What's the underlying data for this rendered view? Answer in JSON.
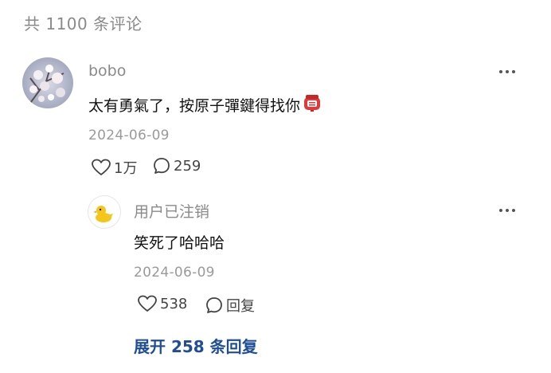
{
  "header": {
    "comment_count_label": "共 1100 条评论"
  },
  "comments": [
    {
      "author": "bobo",
      "text": "太有勇氣了，按原子彈鍵得找你",
      "date": "2024-06-09",
      "likes": "1万",
      "replies": "259",
      "sticker_icon": "red-lantern-sticker-icon"
    },
    {
      "author": "用户已注销",
      "text": "笑死了哈哈哈",
      "date": "2024-06-09",
      "likes": "538",
      "reply_label": "回复",
      "avatar_icon": "duck-avatar-icon"
    }
  ],
  "expand": {
    "label": "展开 258 条回复"
  },
  "colors": {
    "link": "#1f4d96",
    "muted": "#8a8a8a",
    "text": "#121212"
  }
}
